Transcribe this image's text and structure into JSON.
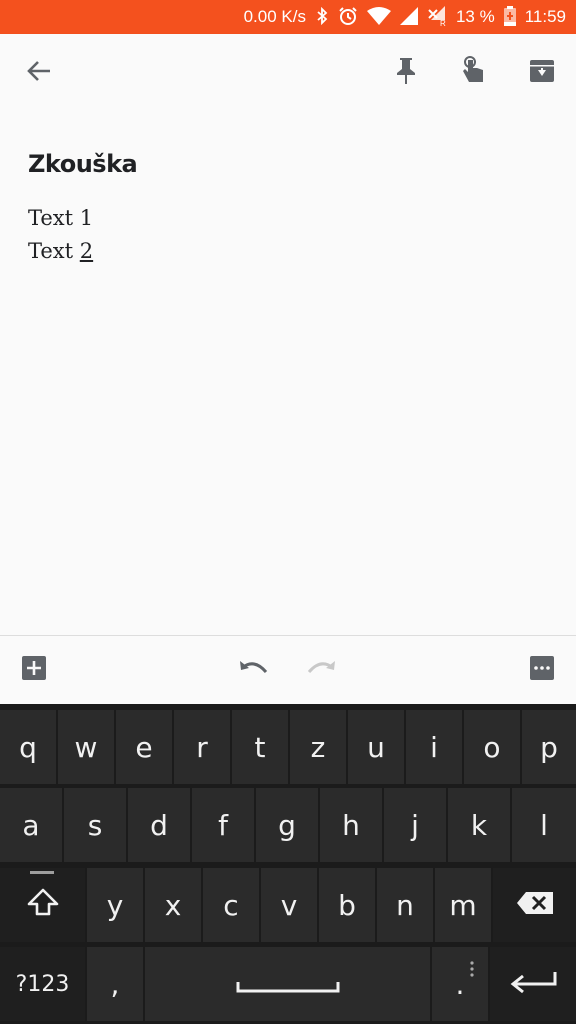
{
  "status_bar": {
    "speed": "0.00 K/s",
    "battery_percent": "13 %",
    "time": "11:59",
    "bg_color": "#f4511e",
    "icons": [
      "bluetooth-icon",
      "alarm-icon",
      "wifi-icon",
      "signal-icon",
      "signal-roaming-icon",
      "battery-charging-icon"
    ]
  },
  "app_bar": {
    "back_icon": "arrow-left-icon",
    "actions": [
      "pin-icon",
      "reminder-finger-icon",
      "archive-icon"
    ]
  },
  "note": {
    "title": "Zkouška",
    "lines": [
      "Text 1",
      "Text ",
      "2"
    ]
  },
  "bottom_bar": {
    "left_icon": "add-box-icon",
    "undo_icon": "undo-icon",
    "redo_icon": "redo-icon",
    "right_icon": "more-icon"
  },
  "keyboard": {
    "row1": [
      "q",
      "w",
      "e",
      "r",
      "t",
      "z",
      "u",
      "i",
      "o",
      "p"
    ],
    "row2": [
      "a",
      "s",
      "d",
      "f",
      "g",
      "h",
      "j",
      "k",
      "l"
    ],
    "row3": [
      "y",
      "x",
      "c",
      "v",
      "b",
      "n",
      "m"
    ],
    "symbols_label": "?123",
    "comma": ",",
    "period": "."
  }
}
